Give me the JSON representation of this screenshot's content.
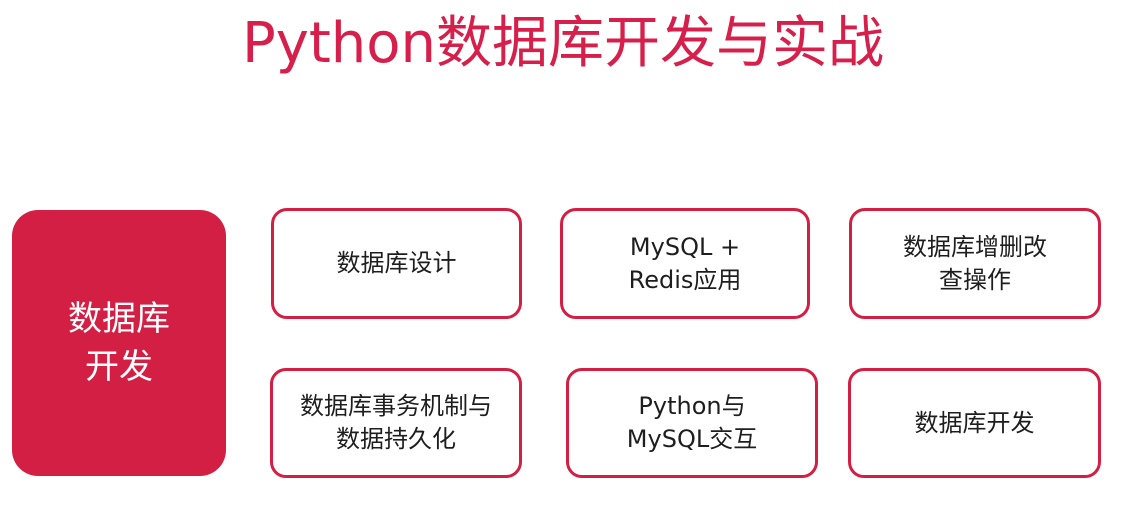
{
  "title": "Python数据库开发与实战",
  "colors": {
    "accent": "#d41f45",
    "title": "#d71f4b",
    "card_text": "#1e1e1e",
    "background": "#ffffff"
  },
  "hub": {
    "label": "数据库\n开发"
  },
  "topics": [
    {
      "label": "数据库设计"
    },
    {
      "label": "MySQL +\nRedis应用"
    },
    {
      "label": "数据库增删改\n查操作"
    },
    {
      "label": "数据库事务机制与\n数据持久化"
    },
    {
      "label": "Python与\nMySQL交互"
    },
    {
      "label": "数据库开发"
    }
  ]
}
